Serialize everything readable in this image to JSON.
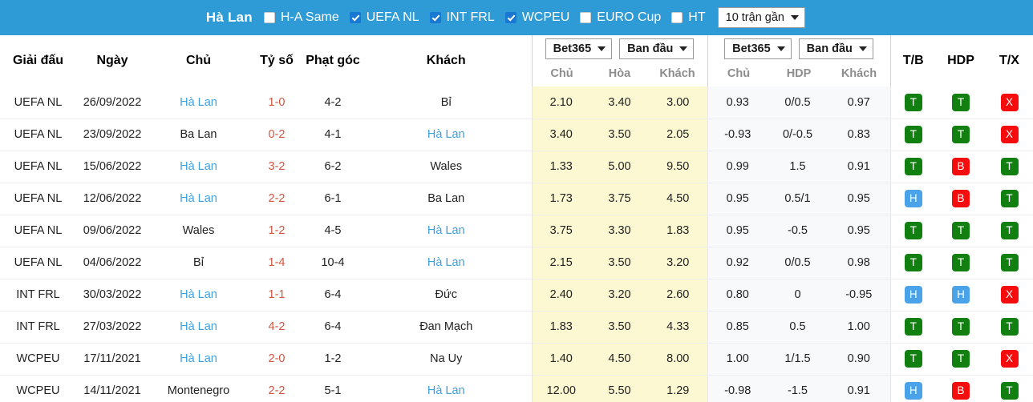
{
  "topbar": {
    "team_name": "Hà Lan",
    "bar_color": "#2e9bd6",
    "filters": [
      {
        "label": "H-A Same",
        "checked": false
      },
      {
        "label": "UEFA NL",
        "checked": true
      },
      {
        "label": "INT FRL",
        "checked": true
      },
      {
        "label": "WCPEU",
        "checked": true
      },
      {
        "label": "EURO Cup",
        "checked": false
      },
      {
        "label": "HT",
        "checked": false
      }
    ],
    "match_count_select": "10 trận gần"
  },
  "table": {
    "headers": {
      "league": "Giải đấu",
      "date": "Ngày",
      "home": "Chủ",
      "score": "Tỷ số",
      "corner": "Phạt góc",
      "away": "Khách",
      "odds_group": {
        "bookmaker": "Bet365",
        "phase": "Ban đầu",
        "sub": [
          "Chủ",
          "Hòa",
          "Khách"
        ]
      },
      "hdp_group": {
        "bookmaker": "Bet365",
        "phase": "Ban đầu",
        "sub": [
          "Chủ",
          "HDP",
          "Khách"
        ]
      },
      "result_cols": [
        "T/B",
        "HDP",
        "T/X"
      ]
    },
    "rows": [
      {
        "league": "UEFA NL",
        "date": "26/09/2022",
        "home": "Hà Lan",
        "home_hl": true,
        "score": "1-0",
        "corner": "4-2",
        "away": "Bỉ",
        "away_hl": false,
        "odds": [
          "2.10",
          "3.40",
          "3.00"
        ],
        "hdp": [
          "0.93",
          "0/0.5",
          "0.97"
        ],
        "badges": [
          "T",
          "T",
          "X"
        ]
      },
      {
        "league": "UEFA NL",
        "date": "23/09/2022",
        "home": "Ba Lan",
        "home_hl": false,
        "score": "0-2",
        "corner": "4-1",
        "away": "Hà Lan",
        "away_hl": true,
        "odds": [
          "3.40",
          "3.50",
          "2.05"
        ],
        "hdp": [
          "-0.93",
          "0/-0.5",
          "0.83"
        ],
        "badges": [
          "T",
          "T",
          "X"
        ]
      },
      {
        "league": "UEFA NL",
        "date": "15/06/2022",
        "home": "Hà Lan",
        "home_hl": true,
        "score": "3-2",
        "corner": "6-2",
        "away": "Wales",
        "away_hl": false,
        "odds": [
          "1.33",
          "5.00",
          "9.50"
        ],
        "hdp": [
          "0.99",
          "1.5",
          "0.91"
        ],
        "badges": [
          "T",
          "B",
          "T"
        ]
      },
      {
        "league": "UEFA NL",
        "date": "12/06/2022",
        "home": "Hà Lan",
        "home_hl": true,
        "score": "2-2",
        "corner": "6-1",
        "away": "Ba Lan",
        "away_hl": false,
        "odds": [
          "1.73",
          "3.75",
          "4.50"
        ],
        "hdp": [
          "0.95",
          "0.5/1",
          "0.95"
        ],
        "badges": [
          "H",
          "B",
          "T"
        ]
      },
      {
        "league": "UEFA NL",
        "date": "09/06/2022",
        "home": "Wales",
        "home_hl": false,
        "score": "1-2",
        "corner": "4-5",
        "away": "Hà Lan",
        "away_hl": true,
        "odds": [
          "3.75",
          "3.30",
          "1.83"
        ],
        "hdp": [
          "0.95",
          "-0.5",
          "0.95"
        ],
        "badges": [
          "T",
          "T",
          "T"
        ]
      },
      {
        "league": "UEFA NL",
        "date": "04/06/2022",
        "home": "Bỉ",
        "home_hl": false,
        "score": "1-4",
        "corner": "10-4",
        "away": "Hà Lan",
        "away_hl": true,
        "odds": [
          "2.15",
          "3.50",
          "3.20"
        ],
        "hdp": [
          "0.92",
          "0/0.5",
          "0.98"
        ],
        "badges": [
          "T",
          "T",
          "T"
        ]
      },
      {
        "league": "INT FRL",
        "date": "30/03/2022",
        "home": "Hà Lan",
        "home_hl": true,
        "score": "1-1",
        "corner": "6-4",
        "away": "Đức",
        "away_hl": false,
        "odds": [
          "2.40",
          "3.20",
          "2.60"
        ],
        "hdp": [
          "0.80",
          "0",
          "-0.95"
        ],
        "badges": [
          "H",
          "H",
          "X"
        ]
      },
      {
        "league": "INT FRL",
        "date": "27/03/2022",
        "home": "Hà Lan",
        "home_hl": true,
        "score": "4-2",
        "corner": "6-4",
        "away": "Đan Mạch",
        "away_hl": false,
        "odds": [
          "1.83",
          "3.50",
          "4.33"
        ],
        "hdp": [
          "0.85",
          "0.5",
          "1.00"
        ],
        "badges": [
          "T",
          "T",
          "T"
        ]
      },
      {
        "league": "WCPEU",
        "date": "17/11/2021",
        "home": "Hà Lan",
        "home_hl": true,
        "score": "2-0",
        "corner": "1-2",
        "away": "Na Uy",
        "away_hl": false,
        "odds": [
          "1.40",
          "4.50",
          "8.00"
        ],
        "hdp": [
          "1.00",
          "1/1.5",
          "0.90"
        ],
        "badges": [
          "T",
          "T",
          "X"
        ]
      },
      {
        "league": "WCPEU",
        "date": "14/11/2021",
        "home": "Montenegro",
        "home_hl": false,
        "score": "2-2",
        "corner": "5-1",
        "away": "Hà Lan",
        "away_hl": true,
        "odds": [
          "12.00",
          "5.50",
          "1.29"
        ],
        "hdp": [
          "-0.98",
          "-1.5",
          "0.91"
        ],
        "badges": [
          "H",
          "B",
          "T"
        ]
      }
    ]
  },
  "colors": {
    "header_blue": "#2e9bd6",
    "link_blue": "#3f9fe0",
    "score_red": "#d4553f",
    "odds_bg": "#fbf8d2",
    "badge_green": "#118011",
    "badge_red": "#f50c0c",
    "badge_blue": "#4aa3e8"
  }
}
